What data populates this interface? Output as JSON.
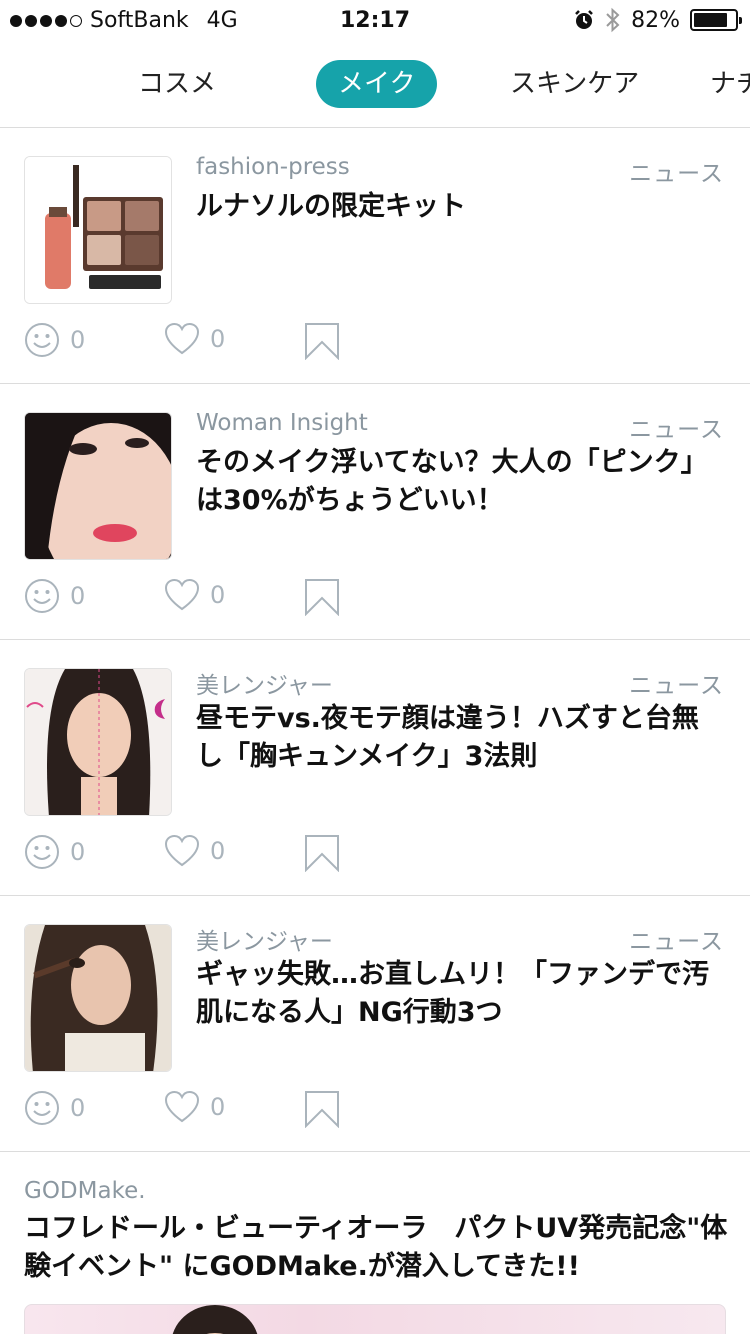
{
  "status_bar": {
    "signal_dots": 5,
    "signal_filled": 4,
    "carrier": "SoftBank",
    "network": "4G",
    "time": "12:17",
    "battery_percent": "82%",
    "battery_level": 0.82,
    "icons": [
      "alarm-icon",
      "bluetooth-icon",
      "battery-icon"
    ]
  },
  "tabs": {
    "items": [
      "コスメ",
      "メイク",
      "スキンケア",
      "ナチ"
    ],
    "active": "メイク",
    "accent_color": "#16a3aa"
  },
  "articles": [
    {
      "source": "fashion-press",
      "category": "ニュース",
      "title": "ルナソルの限定キット",
      "smile_count": "0",
      "like_count": "0"
    },
    {
      "source": "Woman Insight",
      "category": "ニュース",
      "title": "そのメイク浮いてない？大人の「ピンク」は30%がちょうどいい！",
      "smile_count": "0",
      "like_count": "0"
    },
    {
      "source": "美レンジャー",
      "category": "ニュース",
      "title": "昼モテvs.夜モテ顔は違う！ハズすと台無し「胸キュンメイク」3法則",
      "smile_count": "0",
      "like_count": "0"
    },
    {
      "source": "美レンジャー",
      "category": "ニュース",
      "title": "ギャッ失敗…お直しムリ！「ファンデで汚肌になる人」NG行動3つ",
      "smile_count": "0",
      "like_count": "0"
    }
  ],
  "feature": {
    "source": "GODMake.",
    "title": "コフレドール・ビューティオーラ　パクトUV発売記念\"体験イベント\" にGODMake.が潜入してきた!!"
  },
  "colors": {
    "meta_text": "#8b97a0",
    "icon_gray": "#aab4bc",
    "divider": "#dcdcdc"
  }
}
